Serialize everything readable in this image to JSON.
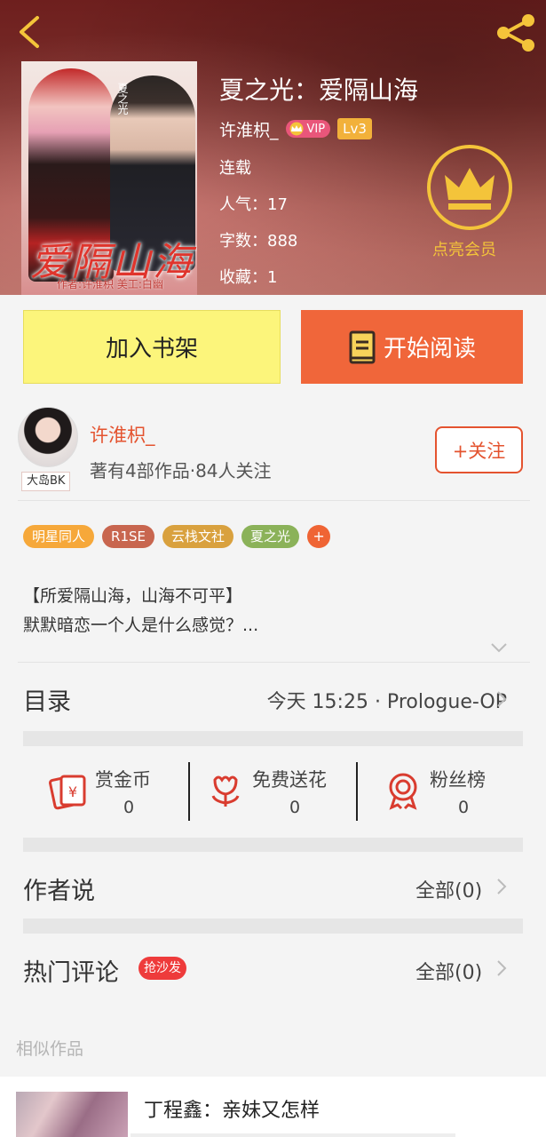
{
  "header": {
    "book_title": "夏之光：爱隔山海",
    "author": "许淮枳_",
    "vip_label": "VIP",
    "level": "Lv3",
    "status": "连载",
    "popularity": "人气：17",
    "word_count": "字数：888",
    "favorites": "收藏：1",
    "member_label": "点亮会员",
    "cover": {
      "title": "爱隔山海",
      "subtitle": "作者:许淮枳 美工:白幽",
      "tag": "夏之光"
    }
  },
  "actions": {
    "add_shelf": "加入书架",
    "start_reading": "开始阅读"
  },
  "author_card": {
    "name": "许淮枳_",
    "stats": "著有4部作品·84人关注",
    "avatar_tag": "大岛BK",
    "follow": "+关注"
  },
  "tags": [
    {
      "label": "明星同人",
      "color": "#f6a83a"
    },
    {
      "label": "R1SE",
      "color": "#c8664f"
    },
    {
      "label": "云栈文社",
      "color": "#d9a13e"
    },
    {
      "label": "夏之光",
      "color": "#8bb259"
    }
  ],
  "tags_more": "+",
  "blurb": {
    "line1": "【所爱隔山海，山海不可平】",
    "line2": "默默暗恋一个人是什么感觉？..."
  },
  "toc": {
    "label": "目录",
    "latest": "今天 15:25 · Prologue-OP"
  },
  "rewards": [
    {
      "label": "赏金币",
      "value": "0",
      "icon": "red-envelope-yen-icon"
    },
    {
      "label": "免费送花",
      "value": "0",
      "icon": "flower-icon"
    },
    {
      "label": "粉丝榜",
      "value": "0",
      "icon": "medal-icon"
    }
  ],
  "author_says": {
    "title": "作者说",
    "all": "全部(0)"
  },
  "hot_comments": {
    "title": "热门评论",
    "badge": "抢沙发",
    "all": "全部(0)"
  },
  "similar": {
    "label": "相似作品",
    "first_title": "丁程鑫：亲妹又怎样"
  },
  "colors": {
    "accent": "#e4532f",
    "read_button": "#f0663a",
    "shelf_button": "#fcf57b",
    "gold": "#f4c43a"
  }
}
